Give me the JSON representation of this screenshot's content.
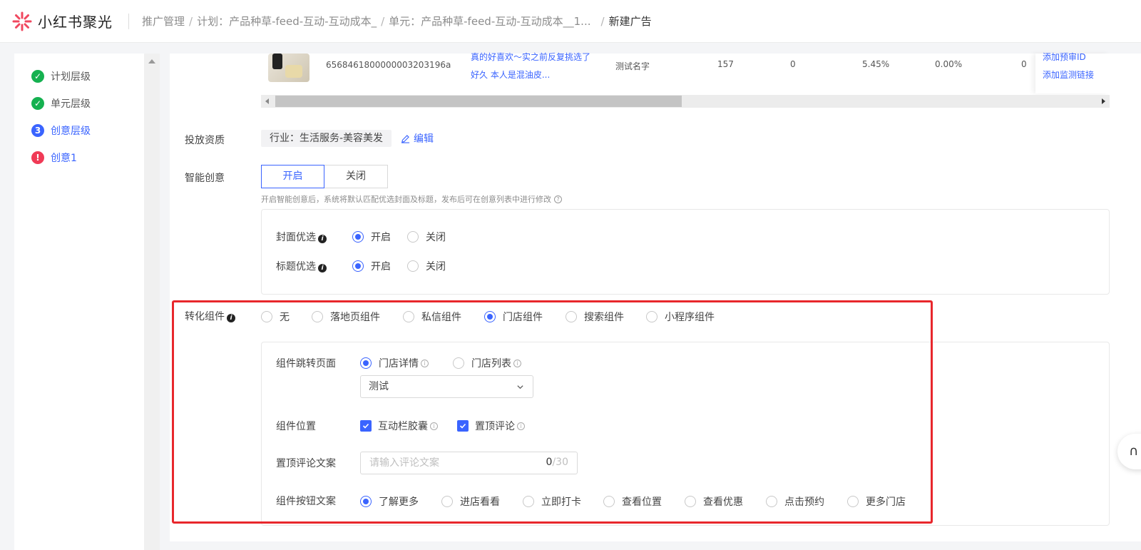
{
  "header": {
    "brand": "小红书聚光",
    "breadcrumbs": [
      "推广管理",
      "计划：产品种草-feed-互动-互动成本_",
      "单元：产品种草-feed-互动-互动成本__1...",
      "新建广告"
    ],
    "separator": "/"
  },
  "sidebar": {
    "steps": [
      {
        "label": "计划层级",
        "status": "done"
      },
      {
        "label": "单元层级",
        "status": "done"
      },
      {
        "label": "创意层级",
        "status": "active",
        "marker": "3"
      },
      {
        "label": "创意1",
        "status": "error",
        "marker": "!"
      }
    ]
  },
  "note_table": {
    "row": {
      "note_id": "6568461800000003203196a",
      "title_line1": "真的好喜欢～实之前反复挑选了",
      "title_line2": "好久 本人是混油皮...",
      "name": "测试名字",
      "col_157": "157",
      "col_0": "0",
      "pct_1": "5.45%",
      "pct_2": "0.00%",
      "col_0b": "0",
      "op_1": "添加预审ID",
      "op_2": "添加监测链接"
    }
  },
  "qualification": {
    "label": "投放资质",
    "tag": "行业：生活服务-美容美发",
    "edit": "编辑"
  },
  "smart_creative": {
    "label": "智能创意",
    "options": [
      "开启",
      "关闭"
    ],
    "selected": "开启",
    "hint": "开启智能创意后，系统将默认匹配优选封面及标题，发布后可在创意列表中进行修改",
    "cover": {
      "label": "封面优选",
      "options": [
        "开启",
        "关闭"
      ],
      "selected": "开启"
    },
    "title": {
      "label": "标题优选",
      "options": [
        "开启",
        "关闭"
      ],
      "selected": "开启"
    }
  },
  "conversion": {
    "label": "转化组件",
    "options": [
      "无",
      "落地页组件",
      "私信组件",
      "门店组件",
      "搜索组件",
      "小程序组件"
    ],
    "selected": "门店组件",
    "jump": {
      "label": "组件跳转页面",
      "options": [
        "门店详情",
        "门店列表"
      ],
      "selected": "门店详情",
      "select_value": "测试"
    },
    "position": {
      "label": "组件位置",
      "options": [
        "互动栏胶囊",
        "置顶评论"
      ],
      "checked": [
        "互动栏胶囊",
        "置顶评论"
      ]
    },
    "comment": {
      "label": "置顶评论文案",
      "placeholder": "请输入评论文案",
      "count": "0",
      "max": "/30"
    },
    "button": {
      "label": "组件按钮文案",
      "options": [
        "了解更多",
        "进店看看",
        "立即打卡",
        "查看位置",
        "查看优惠",
        "点击预约",
        "更多门店"
      ],
      "selected": "了解更多"
    }
  },
  "colors": {
    "accent": "#3a64ff",
    "success": "#15b150",
    "error": "#f03a56",
    "highlight": "#e8272c"
  }
}
